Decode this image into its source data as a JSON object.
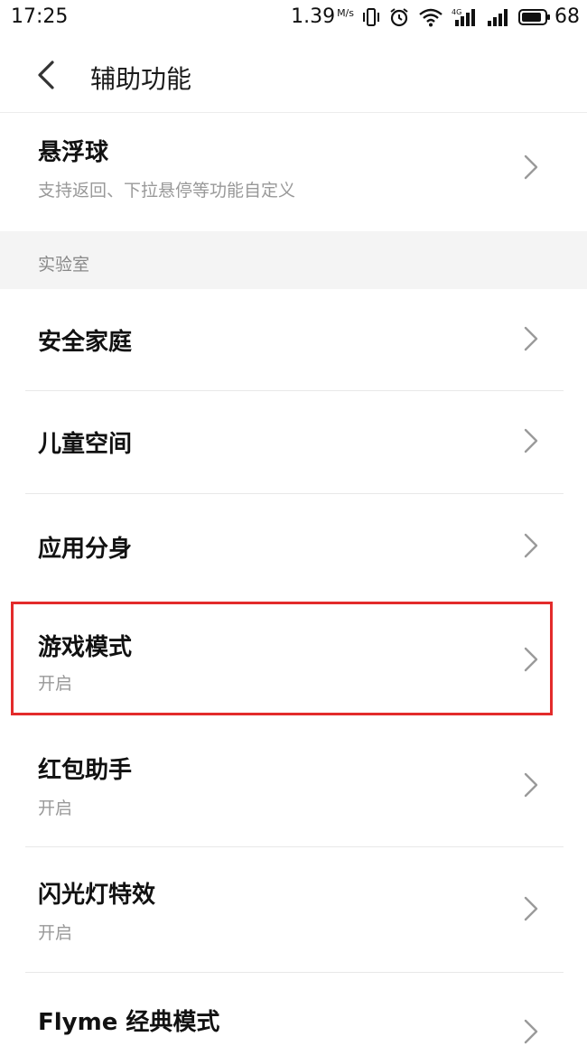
{
  "status_bar": {
    "time": "17:25",
    "net_speed": "1.39",
    "net_unit": "M/s",
    "battery_level": "68",
    "icons": [
      "vibrate-icon",
      "alarm-icon",
      "wifi-icon",
      "signal-4g-icon",
      "signal-icon",
      "battery-icon"
    ]
  },
  "header": {
    "title": "辅助功能",
    "back_icon": "chevron-left-icon"
  },
  "items": {
    "floating_ball": {
      "title": "悬浮球",
      "subtitle": "支持返回、下拉悬停等功能自定义"
    },
    "lab_section": {
      "label": "实验室"
    },
    "safe_family": {
      "title": "安全家庭"
    },
    "kids_space": {
      "title": "儿童空间"
    },
    "app_clone": {
      "title": "应用分身"
    },
    "game_mode": {
      "title": "游戏模式",
      "subtitle": "开启"
    },
    "red_packet": {
      "title": "红包助手",
      "subtitle": "开启"
    },
    "flash_effect": {
      "title": "闪光灯特效",
      "subtitle": "开启"
    },
    "flyme_classic": {
      "title": "Flyme 经典模式"
    }
  },
  "colors": {
    "highlight": "#e32b2b",
    "section_bg": "#f4f4f4",
    "subtitle": "#999999"
  }
}
